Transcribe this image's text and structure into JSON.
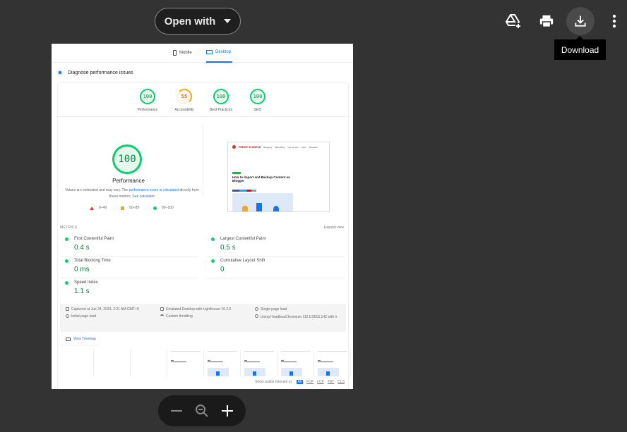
{
  "toolbar": {
    "open_with_label": "Open with",
    "buttons": [
      {
        "name": "add-to-drive",
        "icon": "drive-add-icon"
      },
      {
        "name": "print",
        "icon": "printer-icon"
      },
      {
        "name": "download",
        "icon": "download-icon"
      },
      {
        "name": "more-options",
        "icon": "more-vert-icon"
      }
    ],
    "tooltip": "Download"
  },
  "report": {
    "tabs": [
      {
        "label": "Mobile",
        "icon": "phone-icon",
        "active": false
      },
      {
        "label": "Desktop",
        "icon": "desktop-icon",
        "active": true
      }
    ],
    "diagnose_label": "Diagnose performance issues",
    "categories": [
      {
        "label": "Performance",
        "score": "100",
        "rating": "pass"
      },
      {
        "label": "Accessibility",
        "score": "55",
        "rating": "average"
      },
      {
        "label": "Best Practices",
        "score": "100",
        "rating": "pass"
      },
      {
        "label": "SEO",
        "score": "100",
        "rating": "pass"
      }
    ],
    "main_score": "100",
    "main_label": "Performance",
    "desc_prefix": "Values are estimated and may vary. The ",
    "desc_link1": "performance score is calculated",
    "desc_mid": " directly from these metrics. ",
    "desc_link2": "See calculator",
    "legend": [
      {
        "shape": "triangle",
        "range": "0–49"
      },
      {
        "shape": "square",
        "range": "50–89"
      },
      {
        "shape": "circle",
        "range": "90–100"
      }
    ],
    "screenshot": {
      "site_name": "PRESET'S WORLD",
      "nav_items": [
        "Blogging",
        "Make Blog",
        "Get Income",
        "Apps",
        "Windows"
      ],
      "headline": "How to Import and Backup Content on Blogger"
    },
    "metrics_heading": "METRICS",
    "expand_view": "Expand view",
    "metrics": [
      {
        "name": "First Contentful Paint",
        "value": "0.4 s"
      },
      {
        "name": "Largest Contentful Paint",
        "value": "0.5 s"
      },
      {
        "name": "Total Blocking Time",
        "value": "0 ms"
      },
      {
        "name": "Cumulative Layout Shift",
        "value": "0"
      },
      {
        "name": "Speed Index",
        "value": "1.1 s"
      }
    ],
    "runtime_info": [
      {
        "icon": "calendar-icon",
        "text": "Captured at Jun 24, 2023, 2:21 AM GMT+5"
      },
      {
        "icon": "timer-icon",
        "text": "Initial page load"
      },
      {
        "icon": "devices-icon",
        "text": "Emulated Desktop with Lighthouse 10.2.0"
      },
      {
        "icon": "wifi-icon",
        "text": "Custom throttling"
      },
      {
        "icon": "user-icon",
        "text": "Single page load"
      },
      {
        "icon": "chromium-icon",
        "text": "Using HeadlessChromium 112.0.5615.142 with lr"
      }
    ],
    "treemap_label": "View Treemap",
    "audits_label": "Show audits relevant to:",
    "audit_filters": [
      "All",
      "FCP",
      "LCP",
      "TBT",
      "CLS"
    ]
  },
  "zoom_controls": {
    "zoom_out": "zoom-out",
    "reset": "zoom-reset",
    "zoom_in": "zoom-in"
  }
}
